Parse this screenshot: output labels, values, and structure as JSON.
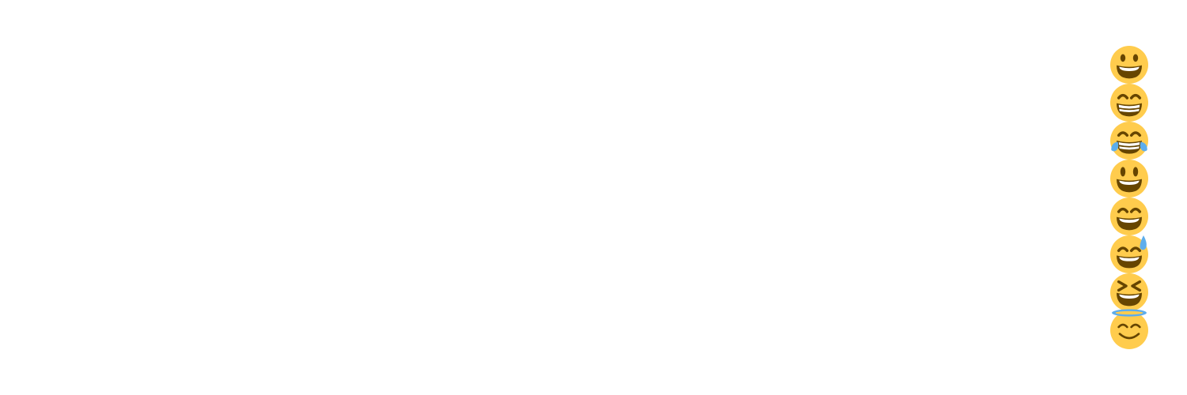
{
  "colors": {
    "face": "#FFCC4D",
    "feature": "#664500",
    "teeth": "#FFFFFF",
    "tear": "#5DADEC"
  },
  "emoji_picker": {
    "items": [
      {
        "name": "grinning-face-icon",
        "glyph": "grinning"
      },
      {
        "name": "beaming-face-icon",
        "glyph": "beaming"
      },
      {
        "name": "face-with-tears-of-joy-icon",
        "glyph": "tears-of-joy"
      },
      {
        "name": "grinning-face-big-eyes-icon",
        "glyph": "big-eyes"
      },
      {
        "name": "grinning-face-smiling-eyes-icon",
        "glyph": "smiling-eyes"
      },
      {
        "name": "grinning-face-with-sweat-icon",
        "glyph": "sweat"
      },
      {
        "name": "squinting-face-icon",
        "glyph": "squinting"
      },
      {
        "name": "smiling-face-with-halo-icon",
        "glyph": "halo"
      }
    ]
  }
}
